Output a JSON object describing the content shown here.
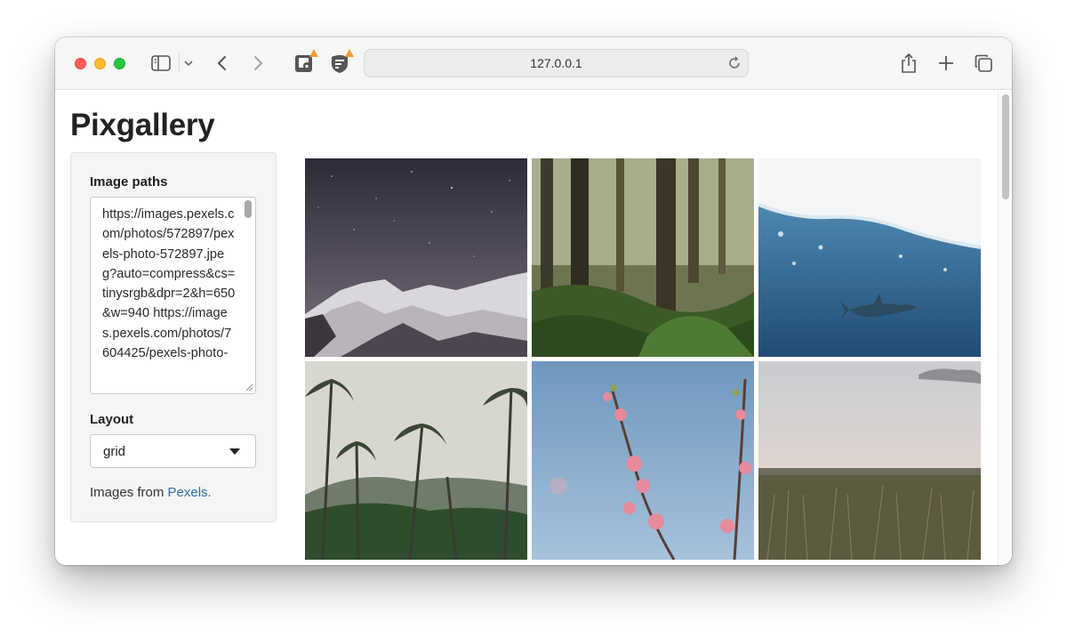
{
  "browser": {
    "url": "127.0.0.1",
    "icons": [
      "sidebar-icon",
      "chevron-down-icon",
      "back-icon",
      "forward-icon",
      "extension-icon",
      "extension-icon",
      "reload-icon",
      "share-icon",
      "plus-icon",
      "tabs-icon"
    ]
  },
  "page": {
    "title": "Pixgallery"
  },
  "panel": {
    "paths_label": "Image paths",
    "paths_value": "https://images.pexels.com/photos/572897/pexels-photo-572897.jpeg?auto=compress&cs=tinysrgb&dpr=2&h=650&w=940 https://images.pexels.com/photos/7604425/pexels-photo-",
    "layout_label": "Layout",
    "layout_value": "grid",
    "credit_prefix": "Images from ",
    "credit_link": "Pexels."
  },
  "colors": {
    "link": "#2f6ea7",
    "close": "#ff5f57",
    "minimize": "#febc2e",
    "zoom": "#28c840",
    "warning": "#f29b2f"
  }
}
